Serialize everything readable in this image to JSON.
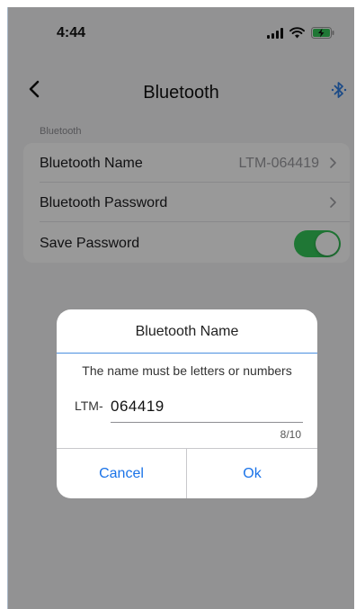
{
  "status_bar": {
    "time": "4:44"
  },
  "nav": {
    "title": "Bluetooth"
  },
  "settings": {
    "section_label": "Bluetooth",
    "rows": [
      {
        "label": "Bluetooth Name",
        "value": "LTM-064419"
      },
      {
        "label": "Bluetooth Password"
      },
      {
        "label": "Save Password",
        "toggle_on": true
      }
    ]
  },
  "dialog": {
    "title": "Bluetooth Name",
    "message": "The name must be letters or numbers",
    "prefix": "LTM-",
    "input_value": "064419",
    "counter": "8/10",
    "cancel_label": "Cancel",
    "ok_label": "Ok"
  },
  "colors": {
    "accent": "#1a73e8",
    "toggle_on": "#34c759",
    "bluetooth_icon": "#2f7de1"
  },
  "icons": [
    "back-chevron-icon",
    "bluetooth-icon",
    "signal-icon",
    "wifi-icon",
    "battery-charging-icon",
    "chevron-right-icon"
  ]
}
